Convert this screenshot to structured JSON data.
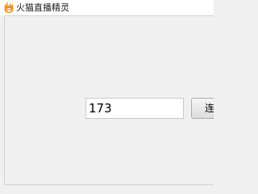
{
  "window": {
    "title": "火猫直播精灵",
    "app_icon": "fire-cat-app-icon"
  },
  "main": {
    "number_input": {
      "value": "173"
    },
    "connect_button": {
      "label": "连接"
    }
  },
  "colors": {
    "icon_orange": "#f28c1c",
    "window_background": "#f0f0f0",
    "titlebar_background": "#ffffff"
  }
}
